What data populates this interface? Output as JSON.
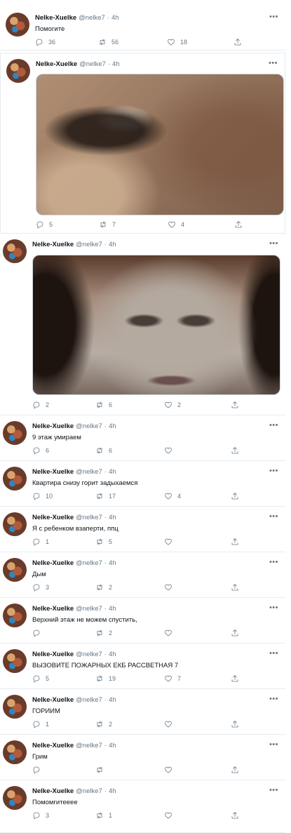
{
  "user": {
    "name": "Nelke-Xuelke",
    "handle": "@nelke7",
    "time": "4h",
    "separator": "·",
    "more": "•••"
  },
  "tweets": [
    {
      "text": "Помогите",
      "replies": "36",
      "retweets": "56",
      "likes": "18"
    },
    {
      "text": "",
      "replies": "5",
      "retweets": "7",
      "likes": "4"
    },
    {
      "text": "",
      "replies": "2",
      "retweets": "6",
      "likes": "2"
    },
    {
      "text": "9 этаж умираем",
      "replies": "6",
      "retweets": "6",
      "likes": ""
    },
    {
      "text": "Квартира снизу горит задыхаемся",
      "replies": "10",
      "retweets": "17",
      "likes": "4"
    },
    {
      "text": "Я с ребенком взаперти, ппц",
      "replies": "1",
      "retweets": "5",
      "likes": ""
    },
    {
      "text": "Дым",
      "replies": "3",
      "retweets": "2",
      "likes": ""
    },
    {
      "text": "Верхний этаж не можем спустить,",
      "replies": "",
      "retweets": "2",
      "likes": ""
    },
    {
      "text": "ВЫЗОВИТЕ ПОЖАРНЫХ ЕКБ РАССВЕТНАЯ 7",
      "replies": "5",
      "retweets": "19",
      "likes": "7"
    },
    {
      "text": "ГОРИИМ",
      "replies": "1",
      "retweets": "2",
      "likes": ""
    },
    {
      "text": "Грим",
      "replies": "",
      "retweets": "",
      "likes": ""
    },
    {
      "text": "Помомгитееее",
      "replies": "3",
      "retweets": "1",
      "likes": ""
    }
  ],
  "icons": {
    "reply": "reply-icon",
    "retweet": "retweet-icon",
    "like": "like-icon",
    "share": "share-icon",
    "more": "more-icon"
  },
  "colors": {
    "secondary_text": "#657786",
    "border": "#e6ecf0"
  }
}
